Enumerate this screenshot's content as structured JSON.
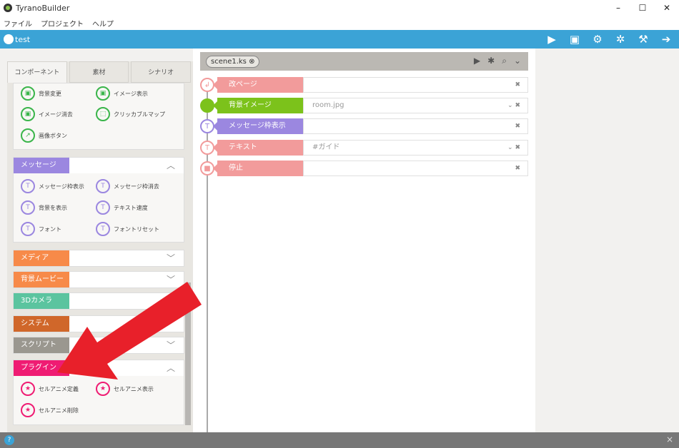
{
  "window": {
    "title": "TyranoBuilder",
    "minimize": "–",
    "maximize": "☐",
    "close": "✕"
  },
  "menu": [
    "ファイル",
    "プロジェクト",
    "ヘルプ"
  ],
  "project": {
    "name": "test"
  },
  "toolbar_icons": [
    "play-icon",
    "save-icon",
    "cogs-icon",
    "gear-icon",
    "hammer-icon",
    "export-icon"
  ],
  "tabs": [
    "コンポーネント",
    "素材",
    "シナリオ"
  ],
  "groups": {
    "top": {
      "items": [
        {
          "label": "背景変更",
          "icon": "bg-change-icon"
        },
        {
          "label": "イメージ表示",
          "icon": "image-show-icon"
        },
        {
          "label": "イメージ消去",
          "icon": "image-erase-icon"
        },
        {
          "label": "クリッカブルマップ",
          "icon": "clickable-map-icon"
        },
        {
          "label": "画像ボタン",
          "icon": "image-button-icon"
        }
      ],
      "color": "#3ab54a"
    },
    "message": {
      "label": "メッセージ",
      "color": "#9b87e0",
      "items": [
        {
          "label": "メッセージ枠表示"
        },
        {
          "label": "メッセージ枠消去"
        },
        {
          "label": "背景を表示"
        },
        {
          "label": "テキスト速度"
        },
        {
          "label": "フォント"
        },
        {
          "label": "フォントリセット"
        }
      ]
    },
    "media": {
      "label": "メディア",
      "color": "#f78a49"
    },
    "movie": {
      "label": "背景ムービー",
      "color": "#f78a49"
    },
    "camera": {
      "label": "3Dカメラ",
      "color": "#5bc49f"
    },
    "system": {
      "label": "システム",
      "color": "#d0672a"
    },
    "script": {
      "label": "スクリプト",
      "color": "#9a978f"
    },
    "plugin": {
      "label": "プラグイン",
      "color": "#ef1c73",
      "items": [
        {
          "label": "セルアニメ定義"
        },
        {
          "label": "セルアニメ表示"
        },
        {
          "label": "セルアニメ削除"
        }
      ]
    }
  },
  "scene": {
    "tab": "scene1.ks ⊗"
  },
  "rows": [
    {
      "label": "改ページ",
      "color": "#f29b9b",
      "value": "",
      "icon": "page-break-icon"
    },
    {
      "label": "背景イメージ",
      "color": "#7cc21b",
      "value": "room.jpg",
      "icon": "background-image-icon"
    },
    {
      "label": "メッセージ枠表示",
      "color": "#9b87e0",
      "value": "",
      "icon": "message-frame-icon"
    },
    {
      "label": "テキスト",
      "color": "#f29b9b",
      "value": "#ガイド",
      "icon": "text-icon"
    },
    {
      "label": "停止",
      "color": "#f29b9b",
      "value": "",
      "icon": "stop-icon"
    }
  ],
  "annotation": {
    "color": "#e8202a",
    "icon": "red-arrow-icon"
  },
  "bottom": {
    "help": "?",
    "close": "×"
  }
}
